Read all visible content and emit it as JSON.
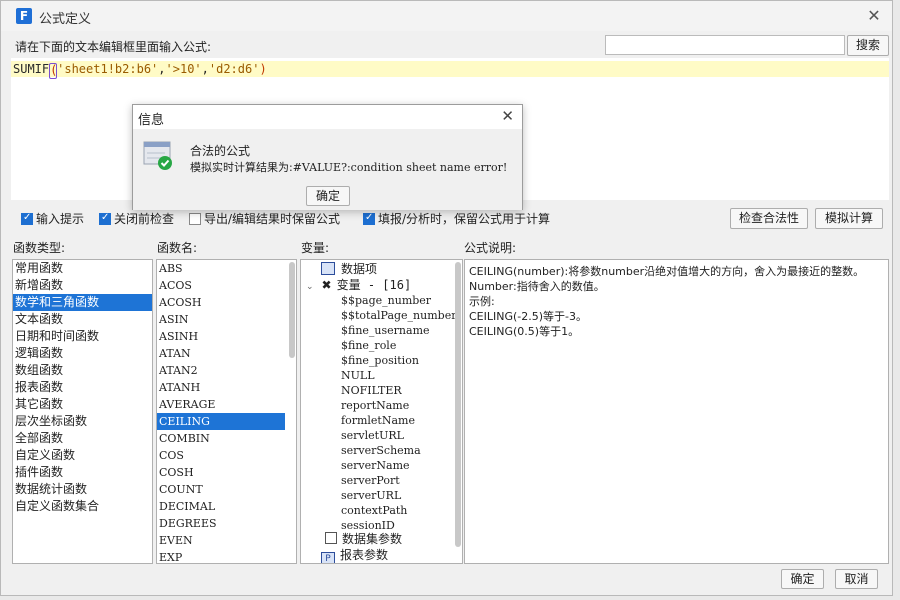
{
  "window": {
    "title": "公式定义",
    "prompt": "请在下面的文本编辑框里面输入公式:",
    "search_button": "搜索",
    "search_placeholder": ""
  },
  "editor": {
    "fn_name": "SUMIF",
    "open_paren": "(",
    "arg1": "'sheet1!b2:b6'",
    "comma1": ",",
    "arg2": "'>10'",
    "comma2": ",",
    "arg3": "'d2:d6'",
    "close_paren": ")"
  },
  "options": {
    "input_hint": "输入提示",
    "close_check": "关闭前检查",
    "keep_formula": "导出/编辑结果时保留公式",
    "fill_keep": "填报/分析时，保留公式用于计算",
    "check_validity": "检查合法性",
    "simulate": "模拟计算"
  },
  "labels": {
    "func_type": "函数类型:",
    "func_name": "函数名:",
    "variables": "变量:",
    "formula_desc": "公式说明:"
  },
  "func_types": [
    "常用函数",
    "新增函数",
    "数学和三角函数",
    "文本函数",
    "日期和时间函数",
    "逻辑函数",
    "数组函数",
    "报表函数",
    "其它函数",
    "层次坐标函数",
    "全部函数",
    "自定义函数",
    "插件函数",
    "数据统计函数",
    "自定义函数集合"
  ],
  "func_type_selected": 2,
  "func_names": [
    "ABS",
    "ACOS",
    "ACOSH",
    "ASIN",
    "ASINH",
    "ATAN",
    "ATAN2",
    "ATANH",
    "AVERAGE",
    "CEILING",
    "COMBIN",
    "COS",
    "COSH",
    "COUNT",
    "DECIMAL",
    "DEGREES",
    "EVEN",
    "EXP"
  ],
  "func_name_selected": 9,
  "variables_tree": {
    "data_items": "数据项",
    "vars_header": "变量 - [16]",
    "vars": [
      "$$page_number",
      "$$totalPage_number",
      "$fine_username",
      "$fine_role",
      "$fine_position",
      "NULL",
      "NOFILTER",
      "reportName",
      "formletName",
      "servletURL",
      "serverSchema",
      "serverName",
      "serverPort",
      "serverURL",
      "contextPath",
      "sessionID"
    ],
    "dataset_params": "数据集参数",
    "report_params": "报表参数"
  },
  "description": {
    "line1": "CEILING(number):将参数number沿绝对值增大的方向，舍入为最接近的整数。",
    "line2": "Number:指待舍入的数值。",
    "line3": "示例:",
    "line4": "CEILING(-2.5)等于-3。",
    "line5": "CEILING(0.5)等于1。"
  },
  "footer": {
    "ok": "确定",
    "cancel": "取消"
  },
  "dialog": {
    "title": "信息",
    "line1": "合法的公式",
    "line2_prefix": "模拟实时计算结果为:",
    "line2_value": "#VALUE?:condition sheet name error!",
    "ok": "确定"
  }
}
